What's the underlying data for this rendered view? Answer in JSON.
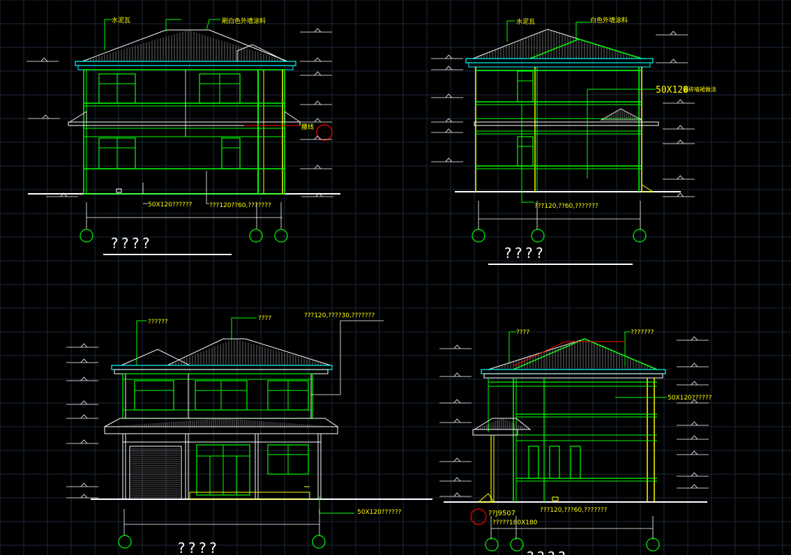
{
  "colors": {
    "background": "#000000",
    "grid": "#1e2a3a",
    "green": "#00ff00",
    "yellow": "#ffff00",
    "cyan": "#00ffff",
    "white": "#ffffff",
    "red": "#ff0000",
    "gray": "#bfbfbf"
  },
  "elevation_1": {
    "label_roof_tile": "水泥瓦",
    "label_wall_paint": "刷白色外墙涂料",
    "label_waist_line": "腰线",
    "label_fascia": "50X120??????",
    "label_beam": "???120??60,???????",
    "title": "????"
  },
  "elevation_2": {
    "label_roof_tile": "水泥瓦",
    "label_wall_paint": "白色外墙涂料",
    "label_fascia_big": "50X120",
    "label_fascia_note": "面砖墙裙做法",
    "label_beam": "???120,??60,???????",
    "title": "????"
  },
  "elevation_3": {
    "label_left": "??????",
    "label_roof": "????",
    "label_right": "???120,????30,???????",
    "label_fascia": "50X120??????",
    "title": "????"
  },
  "elevation_4": {
    "label_left": "????",
    "label_right": "???????",
    "label_fascia": "50X120??????",
    "label_j": "??J9507",
    "label_size": "?????180X180",
    "label_beam": "???120,???60,???????",
    "title": "????"
  }
}
